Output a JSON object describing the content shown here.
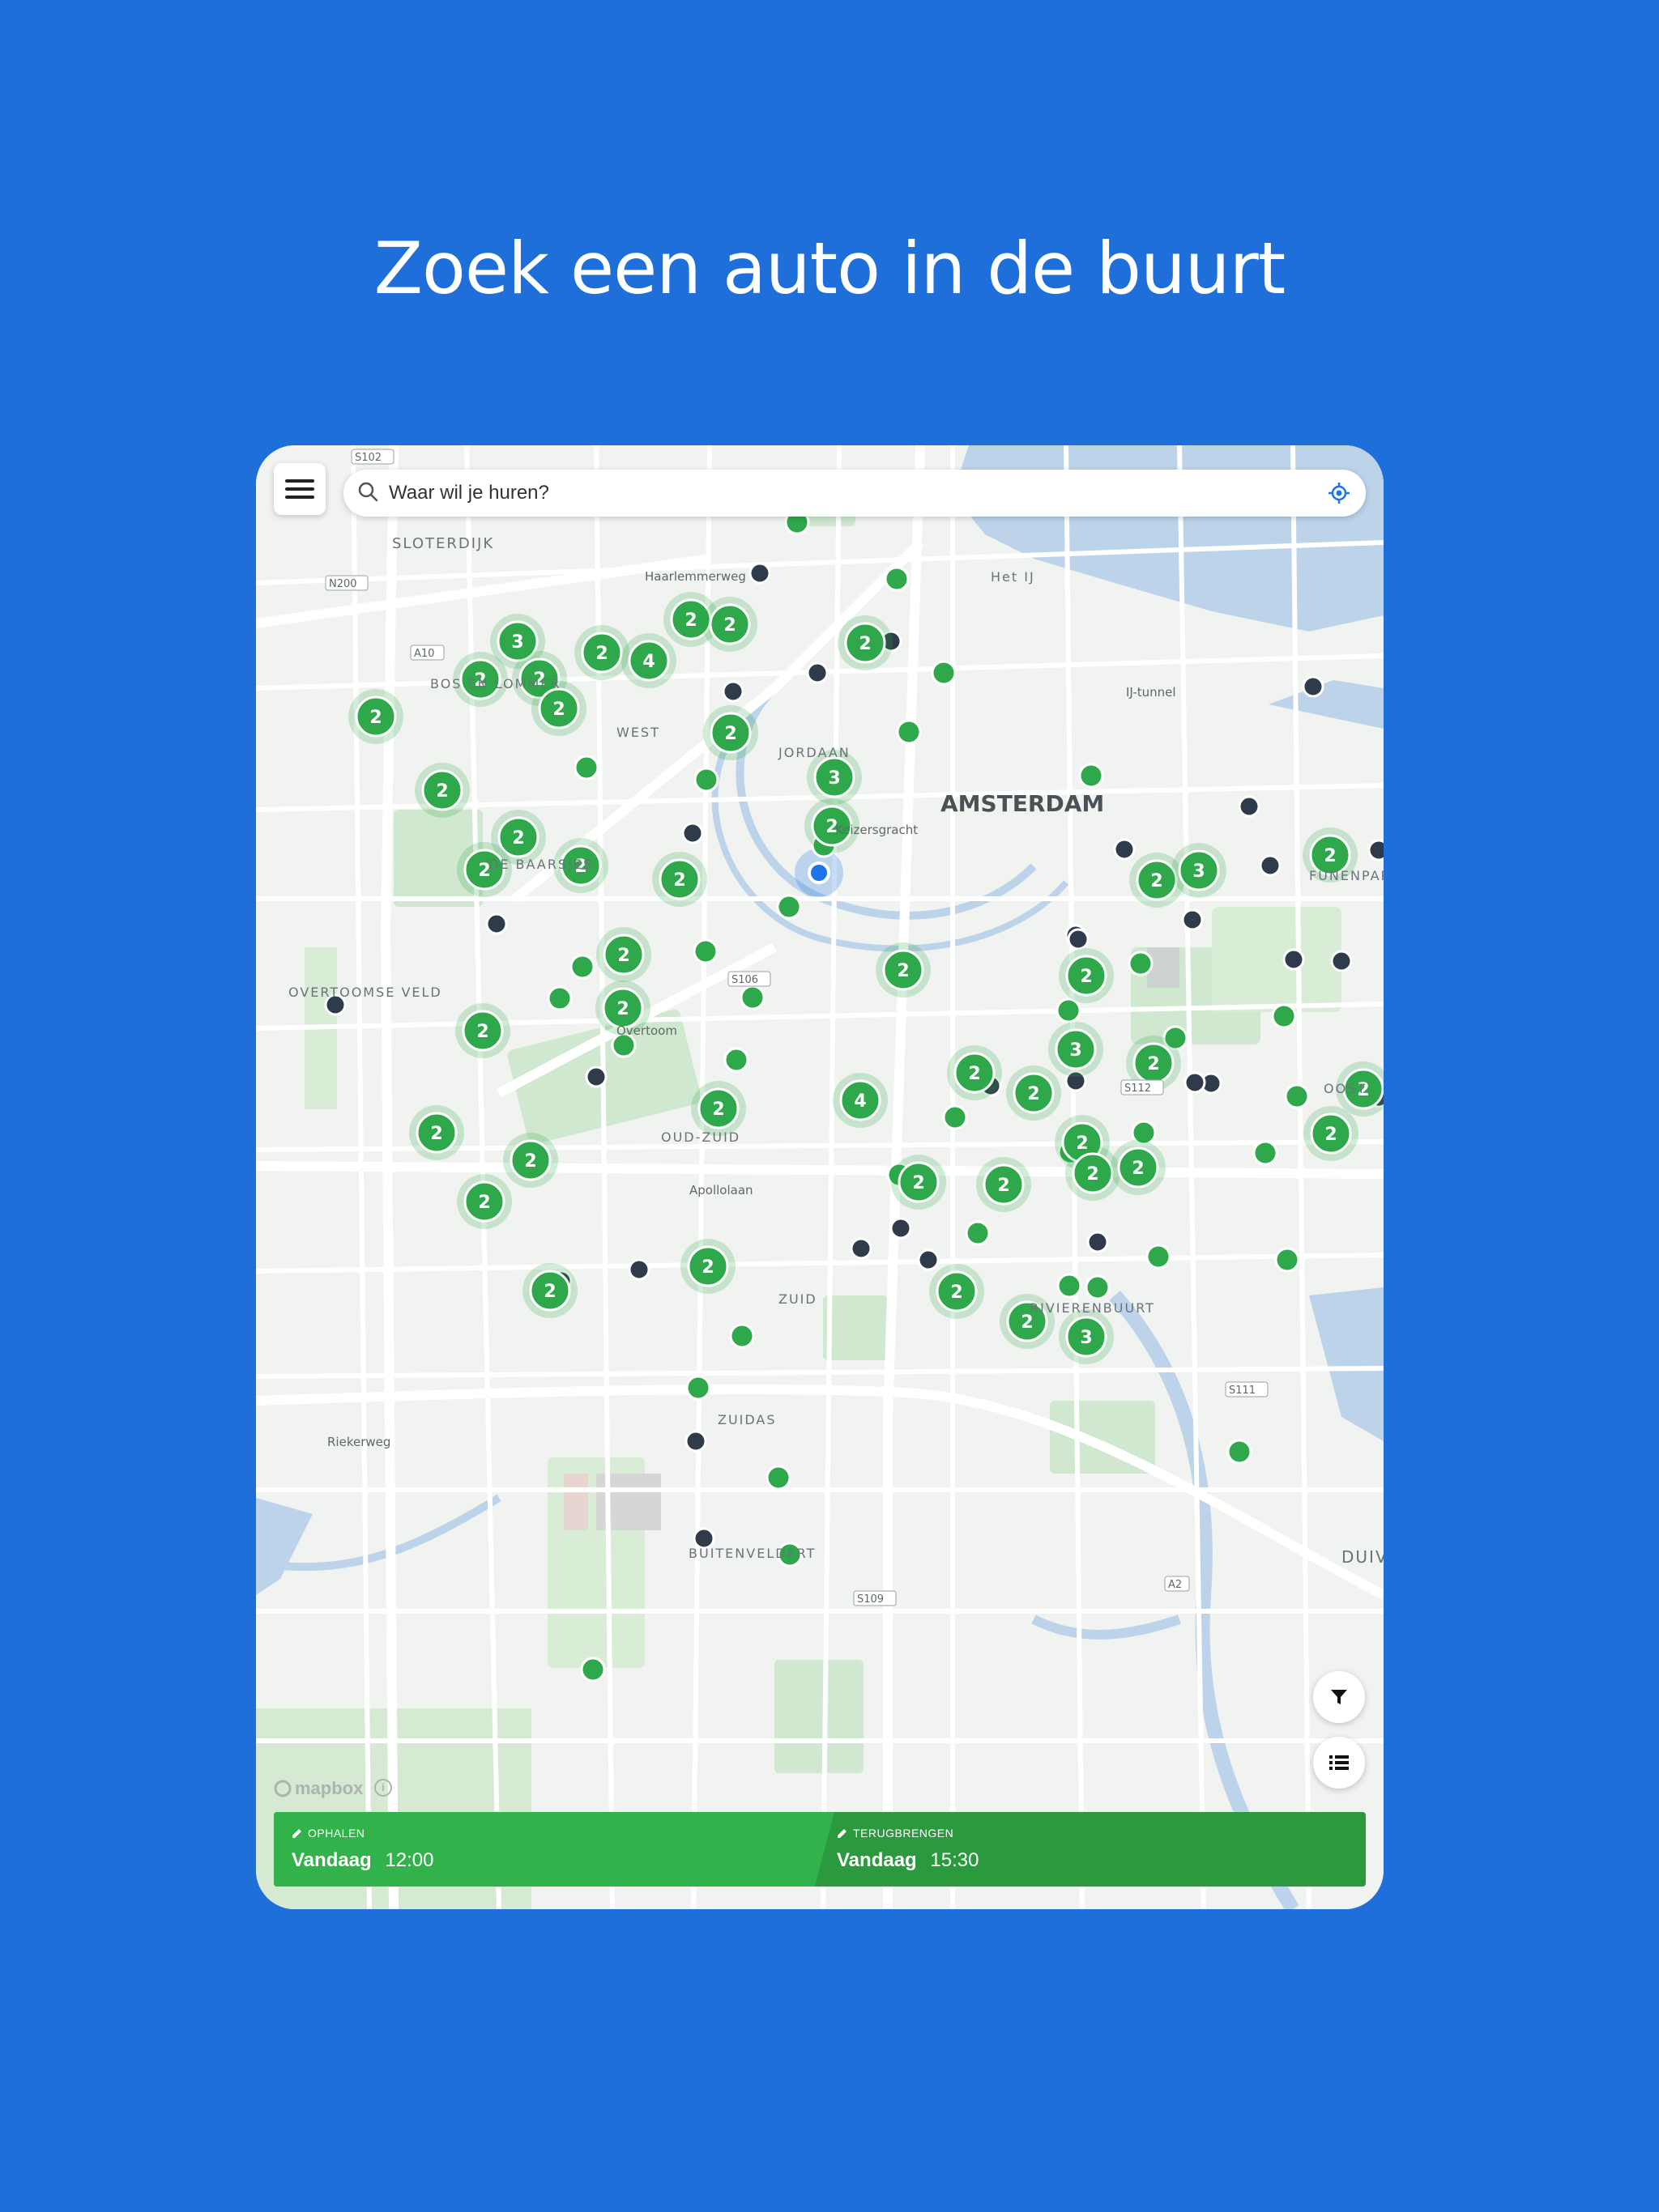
{
  "headline": "Zoek een auto in de buurt",
  "search": {
    "placeholder": "Waar wil je huren?"
  },
  "icons": {
    "menu": "menu-icon",
    "search": "search-icon",
    "locate": "crosshair-icon",
    "filter": "filter-icon",
    "list": "list-icon",
    "edit": "pencil-icon"
  },
  "map": {
    "city_label": "AMSTERDAM",
    "district_labels": [
      "SLOTERDIJK",
      "BOS EN LOMMER",
      "WEST",
      "JORDAAN",
      "DE BAARSJES",
      "OVERTOOMSE VELD",
      "OUD-ZUID",
      "ZUID",
      "ZUIDAS",
      "BUITENVELDERT",
      "RIVIERENBUURT",
      "OOST",
      "FUNENPARK",
      "DUIVENDRECHT",
      "Het IJ"
    ],
    "road_labels": [
      "A10",
      "S106",
      "S102",
      "S112",
      "S109",
      "S111",
      "N200",
      "A2",
      "Haarlemmerweg",
      "Apollolaan",
      "Overtoom",
      "Keizersgracht",
      "IJ-tunnel",
      "Riekerweg"
    ],
    "cluster_counts": [
      2,
      2,
      3,
      2,
      2,
      2,
      2,
      2,
      4,
      2,
      2,
      2,
      3,
      2,
      2,
      2,
      2,
      2,
      2,
      3,
      2,
      2,
      2,
      2,
      2,
      2,
      2,
      3,
      2,
      4,
      2,
      2,
      2,
      2,
      2,
      2,
      2,
      2,
      2,
      2,
      2,
      2,
      2,
      2,
      2,
      2,
      3
    ]
  },
  "attribution": {
    "logo": "mapbox",
    "info": "i"
  },
  "pickup": {
    "caption": "OPHALEN",
    "day": "Vandaag",
    "time": "12:00"
  },
  "return": {
    "caption": "TERUGBRENGEN",
    "day": "Vandaag",
    "time": "15:30"
  },
  "colors": {
    "background": "#1f6fdb",
    "cluster_green": "#2ea84a",
    "pickup_green": "#31b24b",
    "return_green": "#2b9a3f",
    "user_location": "#1e73e8",
    "single_car_dark": "#2f3a4a"
  }
}
